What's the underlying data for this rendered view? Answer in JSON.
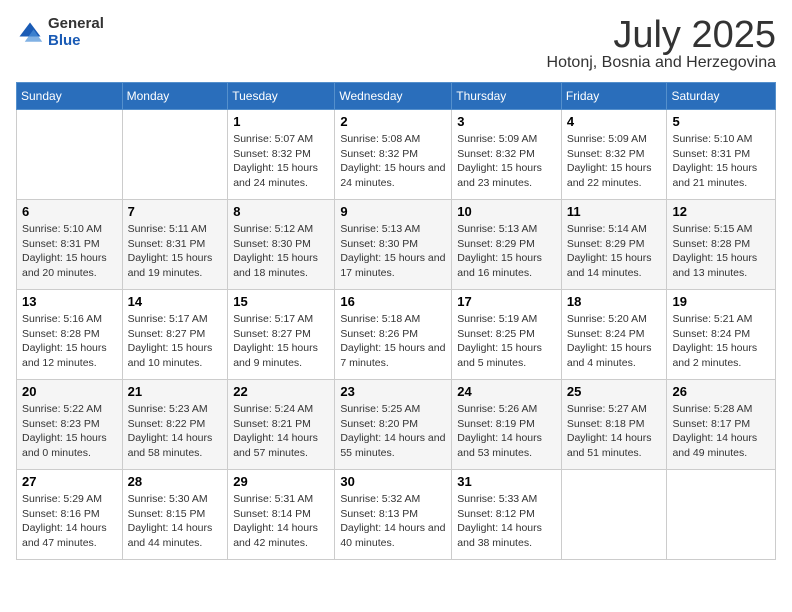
{
  "logo": {
    "general": "General",
    "blue": "Blue"
  },
  "title": "July 2025",
  "location": "Hotonj, Bosnia and Herzegovina",
  "days_of_week": [
    "Sunday",
    "Monday",
    "Tuesday",
    "Wednesday",
    "Thursday",
    "Friday",
    "Saturday"
  ],
  "weeks": [
    [
      {
        "day": "",
        "info": ""
      },
      {
        "day": "",
        "info": ""
      },
      {
        "day": "1",
        "info": "Sunrise: 5:07 AM\nSunset: 8:32 PM\nDaylight: 15 hours and 24 minutes."
      },
      {
        "day": "2",
        "info": "Sunrise: 5:08 AM\nSunset: 8:32 PM\nDaylight: 15 hours and 24 minutes."
      },
      {
        "day": "3",
        "info": "Sunrise: 5:09 AM\nSunset: 8:32 PM\nDaylight: 15 hours and 23 minutes."
      },
      {
        "day": "4",
        "info": "Sunrise: 5:09 AM\nSunset: 8:32 PM\nDaylight: 15 hours and 22 minutes."
      },
      {
        "day": "5",
        "info": "Sunrise: 5:10 AM\nSunset: 8:31 PM\nDaylight: 15 hours and 21 minutes."
      }
    ],
    [
      {
        "day": "6",
        "info": "Sunrise: 5:10 AM\nSunset: 8:31 PM\nDaylight: 15 hours and 20 minutes."
      },
      {
        "day": "7",
        "info": "Sunrise: 5:11 AM\nSunset: 8:31 PM\nDaylight: 15 hours and 19 minutes."
      },
      {
        "day": "8",
        "info": "Sunrise: 5:12 AM\nSunset: 8:30 PM\nDaylight: 15 hours and 18 minutes."
      },
      {
        "day": "9",
        "info": "Sunrise: 5:13 AM\nSunset: 8:30 PM\nDaylight: 15 hours and 17 minutes."
      },
      {
        "day": "10",
        "info": "Sunrise: 5:13 AM\nSunset: 8:29 PM\nDaylight: 15 hours and 16 minutes."
      },
      {
        "day": "11",
        "info": "Sunrise: 5:14 AM\nSunset: 8:29 PM\nDaylight: 15 hours and 14 minutes."
      },
      {
        "day": "12",
        "info": "Sunrise: 5:15 AM\nSunset: 8:28 PM\nDaylight: 15 hours and 13 minutes."
      }
    ],
    [
      {
        "day": "13",
        "info": "Sunrise: 5:16 AM\nSunset: 8:28 PM\nDaylight: 15 hours and 12 minutes."
      },
      {
        "day": "14",
        "info": "Sunrise: 5:17 AM\nSunset: 8:27 PM\nDaylight: 15 hours and 10 minutes."
      },
      {
        "day": "15",
        "info": "Sunrise: 5:17 AM\nSunset: 8:27 PM\nDaylight: 15 hours and 9 minutes."
      },
      {
        "day": "16",
        "info": "Sunrise: 5:18 AM\nSunset: 8:26 PM\nDaylight: 15 hours and 7 minutes."
      },
      {
        "day": "17",
        "info": "Sunrise: 5:19 AM\nSunset: 8:25 PM\nDaylight: 15 hours and 5 minutes."
      },
      {
        "day": "18",
        "info": "Sunrise: 5:20 AM\nSunset: 8:24 PM\nDaylight: 15 hours and 4 minutes."
      },
      {
        "day": "19",
        "info": "Sunrise: 5:21 AM\nSunset: 8:24 PM\nDaylight: 15 hours and 2 minutes."
      }
    ],
    [
      {
        "day": "20",
        "info": "Sunrise: 5:22 AM\nSunset: 8:23 PM\nDaylight: 15 hours and 0 minutes."
      },
      {
        "day": "21",
        "info": "Sunrise: 5:23 AM\nSunset: 8:22 PM\nDaylight: 14 hours and 58 minutes."
      },
      {
        "day": "22",
        "info": "Sunrise: 5:24 AM\nSunset: 8:21 PM\nDaylight: 14 hours and 57 minutes."
      },
      {
        "day": "23",
        "info": "Sunrise: 5:25 AM\nSunset: 8:20 PM\nDaylight: 14 hours and 55 minutes."
      },
      {
        "day": "24",
        "info": "Sunrise: 5:26 AM\nSunset: 8:19 PM\nDaylight: 14 hours and 53 minutes."
      },
      {
        "day": "25",
        "info": "Sunrise: 5:27 AM\nSunset: 8:18 PM\nDaylight: 14 hours and 51 minutes."
      },
      {
        "day": "26",
        "info": "Sunrise: 5:28 AM\nSunset: 8:17 PM\nDaylight: 14 hours and 49 minutes."
      }
    ],
    [
      {
        "day": "27",
        "info": "Sunrise: 5:29 AM\nSunset: 8:16 PM\nDaylight: 14 hours and 47 minutes."
      },
      {
        "day": "28",
        "info": "Sunrise: 5:30 AM\nSunset: 8:15 PM\nDaylight: 14 hours and 44 minutes."
      },
      {
        "day": "29",
        "info": "Sunrise: 5:31 AM\nSunset: 8:14 PM\nDaylight: 14 hours and 42 minutes."
      },
      {
        "day": "30",
        "info": "Sunrise: 5:32 AM\nSunset: 8:13 PM\nDaylight: 14 hours and 40 minutes."
      },
      {
        "day": "31",
        "info": "Sunrise: 5:33 AM\nSunset: 8:12 PM\nDaylight: 14 hours and 38 minutes."
      },
      {
        "day": "",
        "info": ""
      },
      {
        "day": "",
        "info": ""
      }
    ]
  ]
}
